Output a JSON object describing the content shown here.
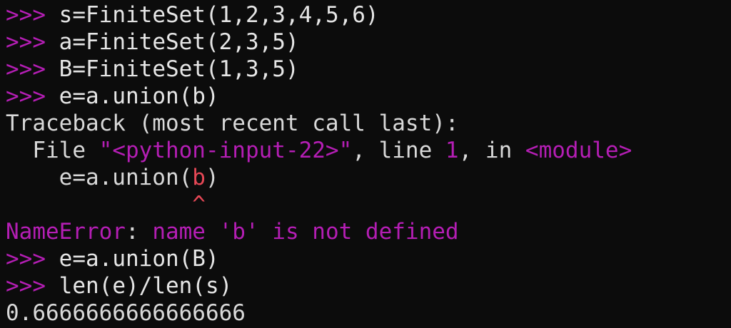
{
  "prompt": ">>>",
  "lines": {
    "l1_cmd": "s=FiniteSet(1,2,3,4,5,6)",
    "l2_cmd": "a=FiniteSet(2,3,5)",
    "l3_cmd": "B=FiniteSet(1,3,5)",
    "l4_cmd": "e=a.union(b)",
    "traceback_header": "Traceback (most recent call last):",
    "tb_file_prefix": "  File ",
    "tb_file_name": "\"<python-input-22>\"",
    "tb_line_sep": ", line ",
    "tb_line_no": "1",
    "tb_in": ", in ",
    "tb_module": "<module>",
    "tb_code_prefix": "    e=a.union(",
    "tb_code_highlight": "b",
    "tb_code_suffix": ")",
    "tb_caret": "              ^",
    "error_name": "NameError",
    "error_sep": ": ",
    "error_msg": "name 'b' is not defined",
    "l5_cmd": "e=a.union(B)",
    "l6_cmd": "len(e)/len(s)",
    "output": "0.6666666666666666"
  }
}
